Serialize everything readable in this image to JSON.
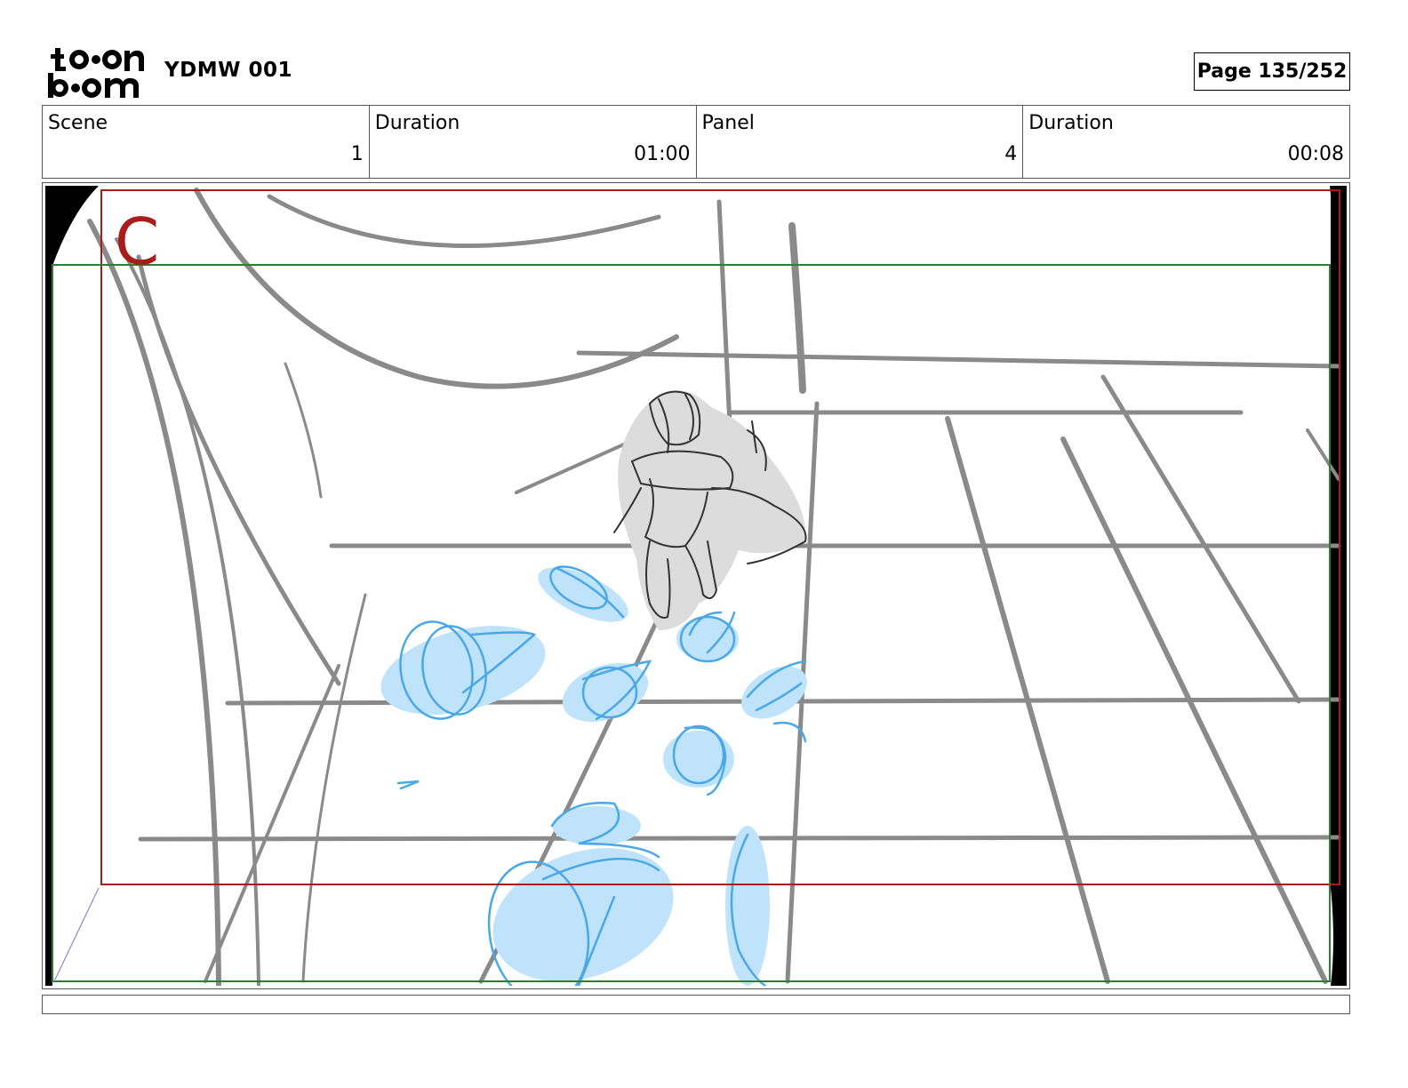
{
  "header": {
    "logo_icon": "toon-boom-logo",
    "project_title": "YDMW 001",
    "page_label": "Page 135/252"
  },
  "info": {
    "scene_label": "Scene",
    "scene_value": "1",
    "scene_duration_label": "Duration",
    "scene_duration_value": "01:00",
    "panel_label": "Panel",
    "panel_value": "4",
    "panel_duration_label": "Duration",
    "panel_duration_value": "00:08"
  },
  "panel": {
    "corner_marker": "C",
    "safe_frame_color": "#a81c1c",
    "title_safe_color": "#2e7d32",
    "sketch_color": "#8a8a8a",
    "fx_color": "#4aa8e8",
    "fx_fill_color": "#bfe3fb"
  },
  "caption": {
    "text": ""
  }
}
